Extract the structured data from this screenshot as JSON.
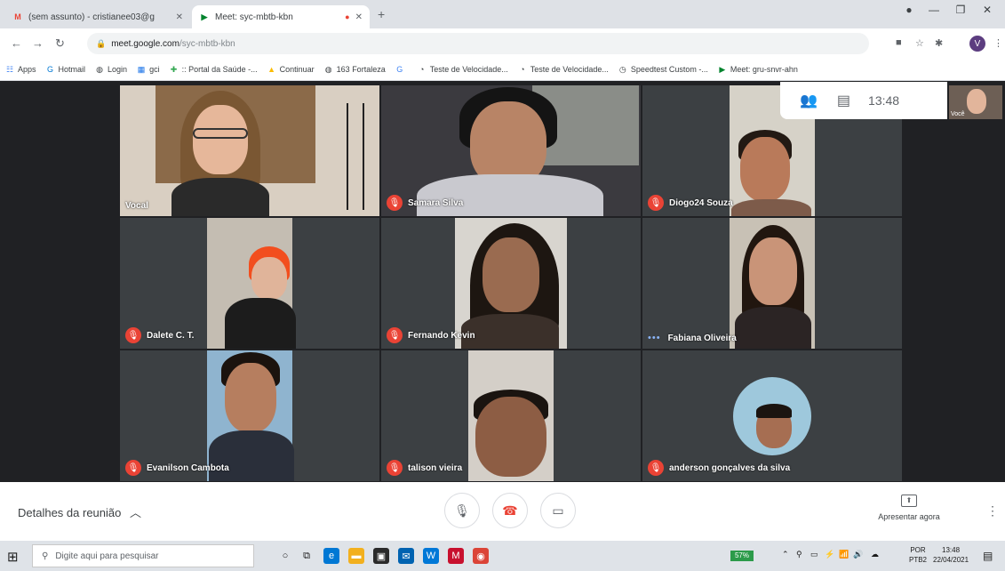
{
  "browser": {
    "tabs": [
      {
        "title": "(sem assunto) - cristianee03@g",
        "icon": "gmail-icon",
        "active": false
      },
      {
        "title": "Meet: syc-mbtb-kbn",
        "icon": "meet-icon",
        "active": true
      }
    ],
    "url_host": "meet.google.com",
    "url_path": "/syc-mbtb-kbn",
    "profile_initial": "V",
    "bookmarks": [
      {
        "label": "Apps",
        "icon": "apps-icon"
      },
      {
        "label": "Hotmail",
        "icon": "hotmail-icon"
      },
      {
        "label": "Login",
        "icon": "globe-icon"
      },
      {
        "label": "gci",
        "icon": "bookmark-icon"
      },
      {
        "label": ":: Portal da Saúde -...",
        "icon": "portal-icon"
      },
      {
        "label": "Continuar",
        "icon": "drive-icon"
      },
      {
        "label": "163 Fortaleza",
        "icon": "globe-icon"
      },
      {
        "label": "G",
        "icon": "google-icon"
      },
      {
        "label": "Teste de Velocidade...",
        "icon": "speed-icon"
      },
      {
        "label": "Teste de Velocidade...",
        "icon": "speed-icon"
      },
      {
        "label": "Speedtest Custom -...",
        "icon": "speedtest-icon"
      },
      {
        "label": "Meet: gru-snvr-ahn",
        "icon": "meet-icon"
      }
    ]
  },
  "meet": {
    "clock": "13:48",
    "participants": [
      {
        "name": "Vocal",
        "muted": false,
        "speaking": false
      },
      {
        "name": "Samara Silva",
        "muted": true,
        "speaking": false
      },
      {
        "name": "Diogo24 Souza",
        "muted": true,
        "speaking": false
      },
      {
        "name": "Dalete C. T.",
        "muted": true,
        "speaking": false
      },
      {
        "name": "Fernando Kevin",
        "muted": true,
        "speaking": false
      },
      {
        "name": "Fabiana Oliveira",
        "muted": false,
        "speaking": true
      },
      {
        "name": "Evanilson Cambota",
        "muted": true,
        "speaking": false
      },
      {
        "name": "talison vieira",
        "muted": true,
        "speaking": false
      },
      {
        "name": "anderson gonçalves da silva",
        "muted": true,
        "speaking": false
      }
    ],
    "self_label": "Você",
    "meeting_details": "Detalhes da reunião",
    "present_label": "Apresentar agora"
  },
  "taskbar": {
    "search_placeholder": "Digite aqui para pesquisar",
    "battery": "57%",
    "lang": "POR",
    "lang_sub": "PTB2",
    "time": "13:48",
    "date": "22/04/2021"
  }
}
